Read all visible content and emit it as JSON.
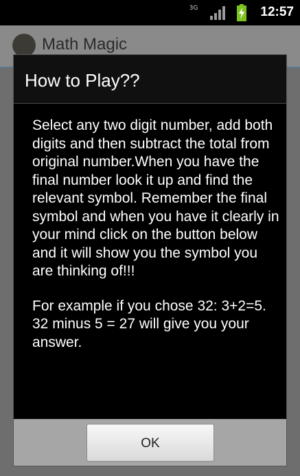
{
  "status_bar": {
    "network_label": "3G",
    "time": "12:57"
  },
  "app": {
    "title": "Math Magic"
  },
  "dialog": {
    "title": "How to Play??",
    "paragraphs": [
      "Select any two digit number, add both digits and then subtract the total from original number.When you have the final number look it up and find the relevant symbol. Remember the final symbol and when you have it clearly in your mind click on the button below and it will show you the symbol you are thinking of!!!",
      "For example if you chose 32: 3+2=5. 32 minus 5 = 27 will give you your answer."
    ],
    "ok_label": "OK"
  },
  "colors": {
    "status_bar": "#000000",
    "dialog_background": "#000000",
    "button_bar": "#a6a6a6",
    "battery": "#7ec21f"
  },
  "icons": [
    "network-3g-icon",
    "signal-icon",
    "battery-charging-icon",
    "app-icon"
  ]
}
